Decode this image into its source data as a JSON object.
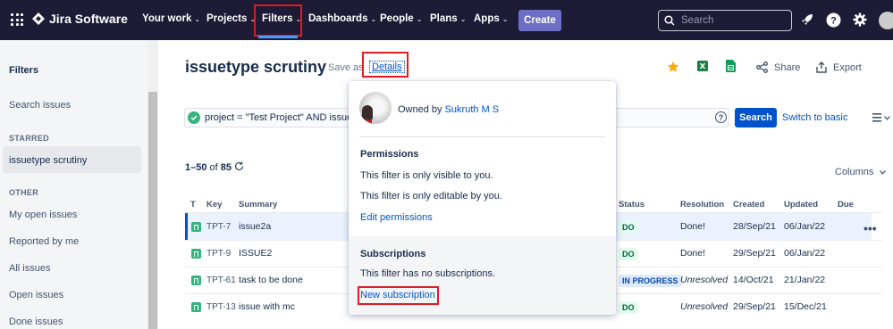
{
  "nav": {
    "logo": "Jira Software",
    "items": [
      {
        "label": "Your work",
        "chevron": true
      },
      {
        "label": "Projects",
        "chevron": true
      },
      {
        "label": "Filters",
        "chevron": true
      },
      {
        "label": "Dashboards",
        "chevron": true
      },
      {
        "label": "People",
        "chevron": true
      },
      {
        "label": "Plans",
        "chevron": true
      },
      {
        "label": "Apps",
        "chevron": true
      }
    ],
    "create_label": "Create",
    "search_placeholder": "Search",
    "icons": [
      "apps-grid-icon",
      "jira-logo-icon",
      "search-icon",
      "rocket-icon",
      "help-icon",
      "settings-icon",
      "avatar"
    ],
    "chevron_glyph": "⌄"
  },
  "sidebar": {
    "title": "Filters",
    "search_issues": "Search issues",
    "starred_heading": "STARRED",
    "starred_item": "issuetype scrutiny",
    "other_heading": "OTHER",
    "other_items": [
      "My open issues",
      "Reported by me",
      "All issues",
      "Open issues",
      "Done issues"
    ]
  },
  "header": {
    "title": "issuetype scrutiny",
    "save_as": "Save as",
    "details": "Details",
    "share": "Share",
    "export": "Export"
  },
  "jql": {
    "query": "project = \"Test Project\" AND issuety",
    "search_button": "Search",
    "switch_basic": "Switch to basic"
  },
  "results": {
    "count_prefix": "1–50",
    "count_of": "of",
    "count_total": "85",
    "columns_label": "Columns",
    "headers": {
      "t": "T",
      "key": "Key",
      "summary": "Summary",
      "status": "Status",
      "resolution": "Resolution",
      "created": "Created",
      "updated": "Updated",
      "due": "Due"
    },
    "rows": [
      {
        "key": "TPT-7",
        "summary": "issue2a",
        "status": "DO",
        "resolution": "Done!",
        "created": "28/Sep/21",
        "updated": "06/Jan/22"
      },
      {
        "key": "TPT-9",
        "summary": "ISSUE2",
        "status": "DO",
        "resolution": "Done!",
        "created": "29/Sep/21",
        "updated": "06/Jan/22"
      },
      {
        "key": "TPT-61",
        "summary": "task to be done",
        "status": "IN PROGRESS",
        "resolution": "Unresolved",
        "created": "14/Oct/21",
        "updated": "21/Jan/22"
      },
      {
        "key": "TPT-13",
        "summary": "issue with mc",
        "status": "DO",
        "resolution": "Unresolved",
        "created": "29/Sep/21",
        "updated": "15/Dec/21"
      }
    ],
    "row_actions": "•••"
  },
  "popup": {
    "owned_by": "Owned by",
    "owner": "Sukruth M S",
    "permissions_heading": "Permissions",
    "visible_text": "This filter is only visible to you.",
    "editable_text": "This filter is only editable by you.",
    "edit_permissions": "Edit permissions",
    "subscriptions_heading": "Subscriptions",
    "no_subscriptions": "This filter has no subscriptions.",
    "new_subscription": "New subscription"
  },
  "colors": {
    "nav_bg": "#1d1b35",
    "accent": "#0052cc",
    "highlight_box": "#e01b24",
    "create_bg": "#6d6fc4",
    "star": "#ffab00"
  }
}
